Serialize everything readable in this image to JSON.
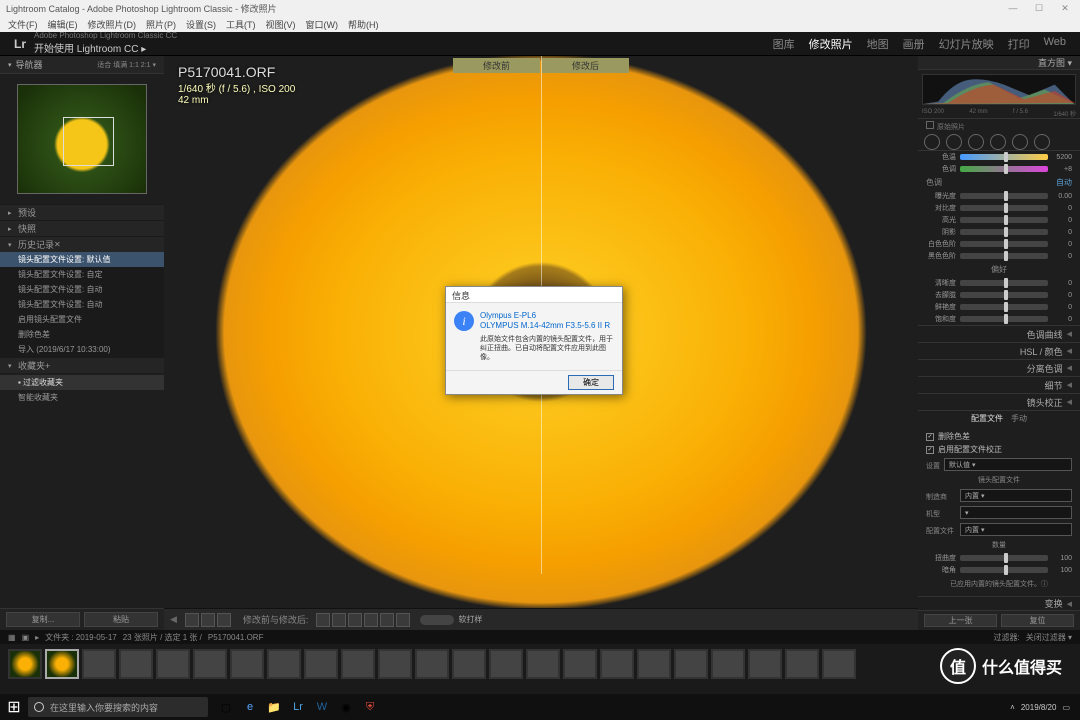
{
  "window": {
    "title": "Lightroom Catalog - Adobe Photoshop Lightroom Classic - 修改照片"
  },
  "menu": [
    "文件(F)",
    "编辑(E)",
    "修改照片(D)",
    "照片(P)",
    "设置(S)",
    "工具(T)",
    "视图(V)",
    "窗口(W)",
    "帮助(H)"
  ],
  "topbar": {
    "brand_sub": "Adobe Photoshop Lightroom Classic CC",
    "brand": "开始使用 Lightroom CC ▸",
    "nav": [
      "图库",
      "修改照片",
      "地图",
      "画册",
      "幻灯片放映",
      "打印",
      "Web"
    ],
    "active_idx": 1
  },
  "left": {
    "nav_title": "导航器",
    "nav_zoom": "适合  填满  1:1  2:1 ▾",
    "sections": [
      "预设",
      "快照",
      "历史记录",
      "收藏夹"
    ],
    "history": [
      "镜头配置文件设置: 默认值",
      "镜头配置文件设置: 自定",
      "镜头配置文件设置: 自动",
      "镜头配置文件设置: 自动",
      "启用镜头配置文件",
      "删除色差",
      "导入 (2019/6/17 10:33:00)"
    ],
    "history_sel": 0,
    "collections": [
      "▪ 过滤收藏夹",
      "智能收藏夹"
    ],
    "copy_btn": "复制...",
    "paste_btn": "粘贴"
  },
  "image": {
    "filename": "P5170041.ORF",
    "meta1": "1/640 秒 (f / 5.6) , ISO 200",
    "meta2": "42 mm",
    "before_lbl": "修改前",
    "after_lbl": "修改后"
  },
  "toolbar": {
    "label_mid": "修改前与修改后:",
    "soft_proof": "软打样"
  },
  "right": {
    "hist_title": "直方图 ▾",
    "hist_marks": [
      "ISO 200",
      "42 mm",
      "f / 5.6",
      "1/640 秒"
    ],
    "orig_label": "原始照片",
    "basic": {
      "wb_row": {
        "l": "色温",
        "v": "5200"
      },
      "tint_row": {
        "l": "色调",
        "v": "+8"
      },
      "tone_hdr": "色调",
      "auto": "自动",
      "rows": [
        {
          "l": "曝光度",
          "v": "0.00"
        },
        {
          "l": "对比度",
          "v": "0"
        },
        {
          "l": "高光",
          "v": "0"
        },
        {
          "l": "阴影",
          "v": "0"
        },
        {
          "l": "白色色阶",
          "v": "0"
        },
        {
          "l": "黑色色阶",
          "v": "0"
        }
      ],
      "presence_hdr": "偏好",
      "presence": [
        {
          "l": "清晰度",
          "v": "0"
        },
        {
          "l": "去朦胧",
          "v": "0"
        },
        {
          "l": "鲜艳度",
          "v": "0"
        },
        {
          "l": "饱和度",
          "v": "0"
        }
      ]
    },
    "collapsed": [
      "色调曲线",
      "HSL / 颜色",
      "分离色调",
      "细节",
      "镜头校正"
    ],
    "profile": {
      "tabs": [
        "配置文件",
        "手动"
      ],
      "chk1": "删除色差",
      "chk2": "启用配置文件校正",
      "setup_lbl": "设置",
      "setup_val": "默认值 ▾",
      "lensprof_hdr": "镜头配置文件",
      "make_lbl": "制造商",
      "make_val": "内置 ▾",
      "model_lbl": "机型",
      "model_val": "▾",
      "prof_lbl": "配置文件",
      "prof_val": "内置 ▾",
      "amount_hdr": "数量",
      "dist": {
        "l": "扭曲度",
        "v": "100"
      },
      "vig": {
        "l": "暗角",
        "v": "100"
      },
      "note": "已应用内置的镜头配置文件。ⓘ"
    },
    "transform": "变换",
    "prev_btn": "上一张",
    "reset_btn": "复位"
  },
  "breadcrumb": {
    "folder": "文件夹 : 2019-05-17",
    "count": "23 张照片 / 选定 1 张 /",
    "file": "P5170041.ORF",
    "filter_lbl": "过滤器:",
    "filter_off": "关闭过滤器 ▾"
  },
  "modal": {
    "title": "信息",
    "camera": "Olympus E-PL6",
    "lens": "OLYMPUS M.14-42mm F3.5-5.6 II R",
    "desc": "此原始文件包含内置的镜头配置文件，用于纠正扭曲。已自动将配置文件应用到此图像。",
    "ok": "确定"
  },
  "taskbar": {
    "search_ph": "在这里输入你要搜索的内容",
    "time": "2019/8/20"
  },
  "watermark": {
    "icon": "值",
    "text": "什么值得买"
  }
}
